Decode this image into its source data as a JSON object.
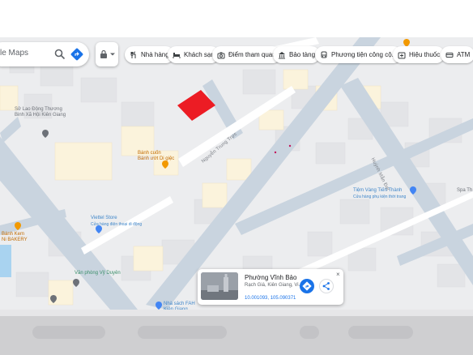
{
  "search": {
    "placeholder": "le Maps"
  },
  "chips": [
    {
      "label": "Nhà hàng",
      "icon": "restaurant-icon"
    },
    {
      "label": "Khách sạn",
      "icon": "hotel-icon"
    },
    {
      "label": "Điểm tham quan",
      "icon": "camera-icon"
    },
    {
      "label": "Bảo tàng",
      "icon": "museum-icon"
    },
    {
      "label": "Phương tiện công cộ...",
      "icon": "transit-icon"
    },
    {
      "label": "Hiệu thuốc",
      "icon": "pharmacy-icon"
    },
    {
      "label": "ATM",
      "icon": "atm-icon"
    }
  ],
  "map_labels": {
    "so_lao_dong": "Sở Lao Động Thương\nBinh Xã Hội Kiên Giang",
    "banh_cuon": "Bánh cuốn\nBánh ướt Di giệc",
    "street_nguyen": "Nguyễn Trung Trực",
    "street_right": "Huỳnh Mẫn Đạt",
    "tiem_vang": "Tiệm Vàng Tiến Thành",
    "tiem_vang_sub": "Cửa hàng phụ kiện thời trang",
    "viettel": "Viettel Store",
    "viettel_sub": "Cửa hàng điện thoại di động",
    "banh_kem": "Bánh Kem\nNi BAKERY",
    "duyen": "Văn phòng Vỹ Duyên",
    "nha_sach": "Nhà sách FAH\nKiên Giang",
    "spa": "Spa Th"
  },
  "info_card": {
    "place": "Phường Vĩnh Bảo",
    "address": "Rạch Giá, Kiên Giang, Vi...",
    "coords": "10.001093, 105.090371",
    "close": "×"
  },
  "colors": {
    "accent": "#1a73e8",
    "road": "#c9d4df",
    "marker": "#ec1c24"
  }
}
